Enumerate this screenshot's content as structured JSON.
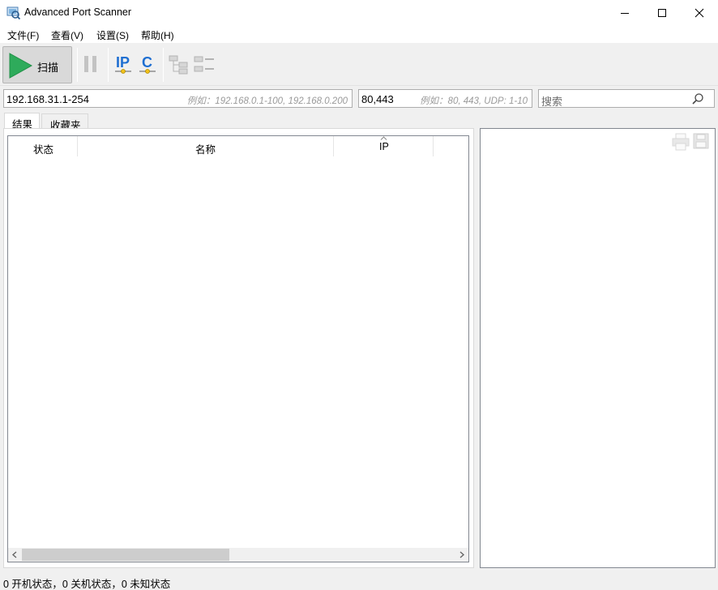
{
  "window": {
    "title": "Advanced Port Scanner",
    "icons": [
      "app-icon",
      "minimize-icon",
      "maximize-icon",
      "close-icon"
    ]
  },
  "menu": {
    "items": [
      {
        "label": "文件(F)"
      },
      {
        "label": "查看(V)"
      },
      {
        "label": "设置(S)"
      },
      {
        "label": "帮助(H)"
      }
    ]
  },
  "toolbar": {
    "scan_label": "扫描",
    "ip_label": "IP",
    "c_label": "C",
    "accent": "#2eab5b",
    "icons": [
      "play-icon",
      "pause-icon",
      "ip-icon",
      "c-icon",
      "expand-tree-icon",
      "collapse-list-icon"
    ]
  },
  "ip_range": {
    "value": "192.168.31.1-254",
    "hint": "例如：192.168.0.1-100, 192.168.0.200"
  },
  "ports": {
    "value": "80,443",
    "hint": "例如：80, 443, UDP: 1-10"
  },
  "search": {
    "placeholder": "搜索"
  },
  "tabs": [
    {
      "label": "结果",
      "active": true
    },
    {
      "label": "收藏夹",
      "active": false
    }
  ],
  "table": {
    "columns": [
      "状态",
      "名称",
      "IP"
    ],
    "rows": []
  },
  "status_bar": {
    "text": "0 开机状态，0 关机状态，0 未知状态"
  }
}
